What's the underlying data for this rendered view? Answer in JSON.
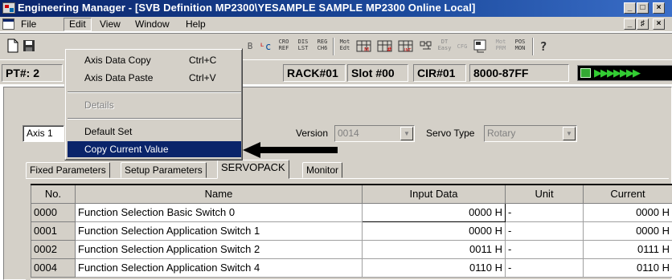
{
  "window": {
    "title": "Engineering Manager - [SVB Definition   MP2300\\YESAMPLE SAMPLE MP2300   Online Local]",
    "app_icon": "engineering-manager-icon",
    "controls": [
      "_",
      "□",
      "×"
    ]
  },
  "menubar": {
    "items": [
      "File",
      "Edit",
      "View",
      "Window",
      "Help"
    ],
    "active": "Edit",
    "mdi_controls": [
      "_",
      "♯",
      "×"
    ]
  },
  "toolbar": {
    "buttons": [
      {
        "icon": "new-file-icon",
        "label": ""
      },
      {
        "icon": "save-icon",
        "label": ""
      },
      {
        "icon": "svb-tool-icon",
        "label": "B"
      },
      {
        "icon": "route-icon",
        "label": "ᵃ"
      },
      {
        "icon": "cro-ref-icon",
        "label": "CRO REF"
      },
      {
        "icon": "dis-lst-icon",
        "label": "DIS LST"
      },
      {
        "icon": "reg-ch6-icon",
        "label": "REG CH6"
      },
      {
        "icon": "mot-edt-icon",
        "label": "Mot Edt"
      },
      {
        "icon": "mot-icon",
        "label": "M"
      },
      {
        "icon": "hash-icon",
        "label": "#"
      },
      {
        "icon": "int-icon",
        "label": "INT"
      },
      {
        "icon": "easy-icon",
        "label": "DT Easy"
      },
      {
        "icon": "cfg-icon",
        "label": "CFG"
      },
      {
        "icon": "config-icon",
        "label": ""
      },
      {
        "icon": "mot-prm-icon",
        "label": "Mot PRM"
      },
      {
        "icon": "pos-mon-icon",
        "label": "POS MON"
      },
      {
        "icon": "help-icon",
        "label": "?"
      }
    ]
  },
  "inforow": {
    "pt": "PT#: 2",
    "rack": "RACK#01",
    "slot": "Slot #00",
    "cir": "CIR#01",
    "range": "8000-87FF",
    "status_arrows": "▶▶▶▶▶▶▶"
  },
  "panel": {
    "axis_value": "Axis 1",
    "version_label": "Version",
    "version_value": "0014",
    "servo_type_label": "Servo Type",
    "servo_type_value": "Rotary"
  },
  "tabs": [
    "Fixed Parameters",
    "Setup Parameters",
    "SERVOPACK",
    "Monitor"
  ],
  "active_tab": "SERVOPACK",
  "grid": {
    "headers": [
      "No.",
      "Name",
      "Input Data",
      "Unit",
      "Current"
    ],
    "rows": [
      {
        "no": "0000",
        "name": "Function Selection Basic Switch 0",
        "input": "0000 H",
        "unit": "-",
        "current": "0000 H"
      },
      {
        "no": "0001",
        "name": "Function Selection Application Switch 1",
        "input": "0000 H",
        "unit": "-",
        "current": "0000 H"
      },
      {
        "no": "0002",
        "name": "Function Selection Application Switch 2",
        "input": "0011 H",
        "unit": "-",
        "current": "0111 H"
      },
      {
        "no": "0004",
        "name": "Function Selection Application Switch 4",
        "input": "0110 H",
        "unit": "-",
        "current": "0110 H"
      }
    ]
  },
  "edit_menu": {
    "items": [
      {
        "label": "Axis Data Copy",
        "shortcut": "Ctrl+C",
        "disabled": false
      },
      {
        "label": "Axis Data Paste",
        "shortcut": "Ctrl+V",
        "disabled": false
      },
      {
        "label": "Details",
        "shortcut": "",
        "disabled": true
      },
      {
        "label": "Default Set",
        "shortcut": "",
        "disabled": false
      },
      {
        "label": "Copy Current Value",
        "shortcut": "",
        "disabled": false,
        "highlighted": true
      }
    ]
  },
  "colors": {
    "title_bar": "#0a246a",
    "face": "#d4d0c8",
    "highlight": "#0a246a"
  }
}
